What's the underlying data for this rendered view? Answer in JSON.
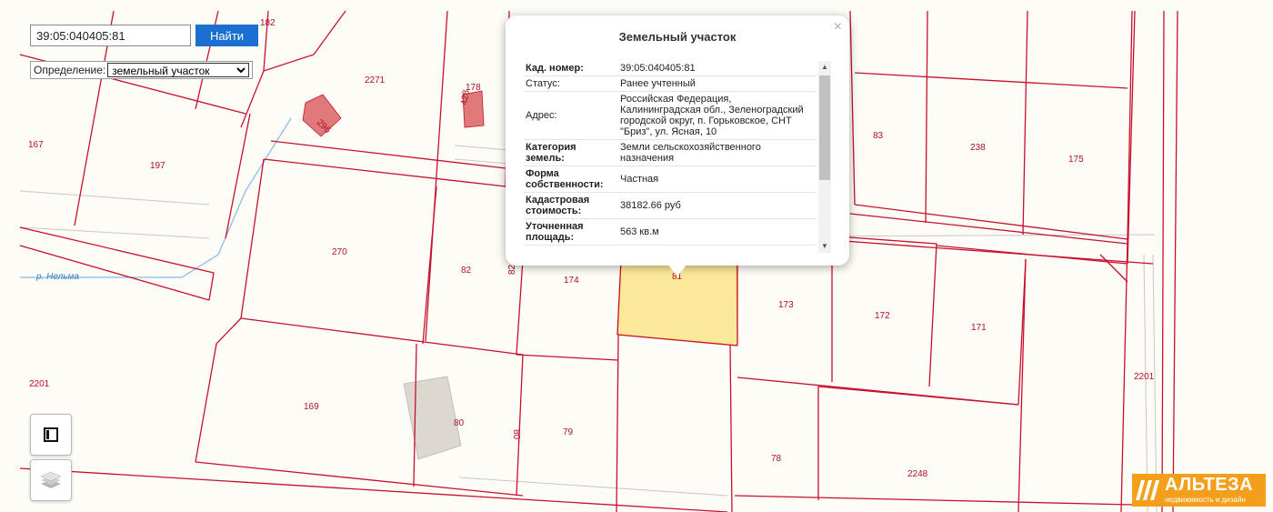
{
  "search": {
    "value": "39:05:040405:81",
    "button_label": "Найти"
  },
  "definition": {
    "label": "Определение:",
    "selected": "земельный участок"
  },
  "map": {
    "plot_labels": [
      "182",
      "2271",
      "178",
      "428",
      "29б",
      "167",
      "197",
      "270",
      "82",
      "82",
      "174",
      "81",
      "83",
      "238",
      "175",
      "173",
      "172",
      "171",
      "2201",
      "2201",
      "169",
      "80",
      "80",
      "79",
      "78",
      "2248"
    ],
    "river_label": "р. Нельма",
    "colors": {
      "boundary": "#c8102e",
      "selected_fill": "#fbe89a",
      "building_fill": "#e07a7a",
      "background": "#fdfcf6"
    }
  },
  "popup": {
    "title": "Земельный участок",
    "close_icon": "close-icon",
    "rows": [
      {
        "key": "Кад. номер:",
        "value": "39:05:040405:81",
        "bold": true
      },
      {
        "key": "Статус:",
        "value": "Ранее учтенный",
        "bold": false
      },
      {
        "key": "Адрес:",
        "value": "Российская Федерация, Калининградская обл., Зеленоградский городской округ, п. Горьковское, СНТ \"Бриз\", ул. Ясная, 10",
        "bold": false
      },
      {
        "key": "Категория земель:",
        "value": "Земли сельскохозяйственного назначения",
        "bold": true
      },
      {
        "key": "Форма собственности:",
        "value": "Частная",
        "bold": true
      },
      {
        "key": "Кадастровая стоимость:",
        "value": "38182.66 руб",
        "bold": true
      },
      {
        "key": "Уточненная площадь:",
        "value": "563 кв.м",
        "bold": true
      }
    ]
  },
  "logo": {
    "name": "АЛЬТЕЗА",
    "tagline": "недвижимость и дизайн"
  },
  "controls": {
    "basemap_icon": "map-sheet-icon",
    "layers_icon": "layers-icon"
  }
}
